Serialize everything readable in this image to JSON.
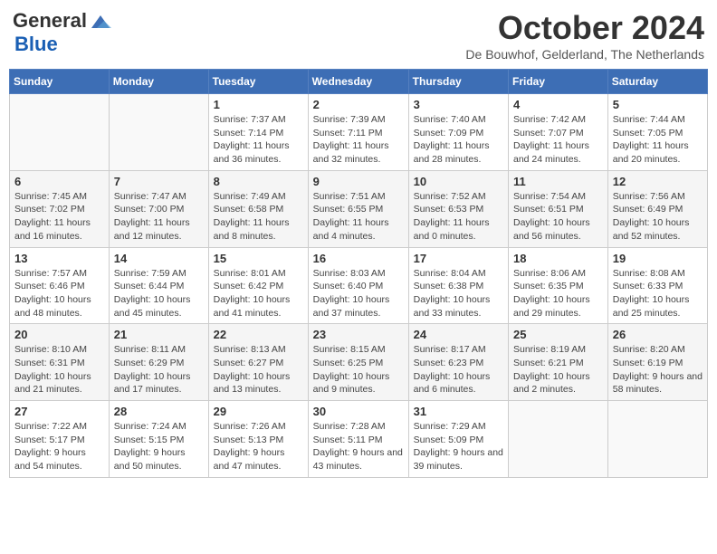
{
  "logo": {
    "general": "General",
    "blue": "Blue"
  },
  "header": {
    "title": "October 2024",
    "subtitle": "De Bouwhof, Gelderland, The Netherlands"
  },
  "days_of_week": [
    "Sunday",
    "Monday",
    "Tuesday",
    "Wednesday",
    "Thursday",
    "Friday",
    "Saturday"
  ],
  "weeks": [
    [
      {
        "day": "",
        "info": ""
      },
      {
        "day": "",
        "info": ""
      },
      {
        "day": "1",
        "info": "Sunrise: 7:37 AM\nSunset: 7:14 PM\nDaylight: 11 hours and 36 minutes."
      },
      {
        "day": "2",
        "info": "Sunrise: 7:39 AM\nSunset: 7:11 PM\nDaylight: 11 hours and 32 minutes."
      },
      {
        "day": "3",
        "info": "Sunrise: 7:40 AM\nSunset: 7:09 PM\nDaylight: 11 hours and 28 minutes."
      },
      {
        "day": "4",
        "info": "Sunrise: 7:42 AM\nSunset: 7:07 PM\nDaylight: 11 hours and 24 minutes."
      },
      {
        "day": "5",
        "info": "Sunrise: 7:44 AM\nSunset: 7:05 PM\nDaylight: 11 hours and 20 minutes."
      }
    ],
    [
      {
        "day": "6",
        "info": "Sunrise: 7:45 AM\nSunset: 7:02 PM\nDaylight: 11 hours and 16 minutes."
      },
      {
        "day": "7",
        "info": "Sunrise: 7:47 AM\nSunset: 7:00 PM\nDaylight: 11 hours and 12 minutes."
      },
      {
        "day": "8",
        "info": "Sunrise: 7:49 AM\nSunset: 6:58 PM\nDaylight: 11 hours and 8 minutes."
      },
      {
        "day": "9",
        "info": "Sunrise: 7:51 AM\nSunset: 6:55 PM\nDaylight: 11 hours and 4 minutes."
      },
      {
        "day": "10",
        "info": "Sunrise: 7:52 AM\nSunset: 6:53 PM\nDaylight: 11 hours and 0 minutes."
      },
      {
        "day": "11",
        "info": "Sunrise: 7:54 AM\nSunset: 6:51 PM\nDaylight: 10 hours and 56 minutes."
      },
      {
        "day": "12",
        "info": "Sunrise: 7:56 AM\nSunset: 6:49 PM\nDaylight: 10 hours and 52 minutes."
      }
    ],
    [
      {
        "day": "13",
        "info": "Sunrise: 7:57 AM\nSunset: 6:46 PM\nDaylight: 10 hours and 48 minutes."
      },
      {
        "day": "14",
        "info": "Sunrise: 7:59 AM\nSunset: 6:44 PM\nDaylight: 10 hours and 45 minutes."
      },
      {
        "day": "15",
        "info": "Sunrise: 8:01 AM\nSunset: 6:42 PM\nDaylight: 10 hours and 41 minutes."
      },
      {
        "day": "16",
        "info": "Sunrise: 8:03 AM\nSunset: 6:40 PM\nDaylight: 10 hours and 37 minutes."
      },
      {
        "day": "17",
        "info": "Sunrise: 8:04 AM\nSunset: 6:38 PM\nDaylight: 10 hours and 33 minutes."
      },
      {
        "day": "18",
        "info": "Sunrise: 8:06 AM\nSunset: 6:35 PM\nDaylight: 10 hours and 29 minutes."
      },
      {
        "day": "19",
        "info": "Sunrise: 8:08 AM\nSunset: 6:33 PM\nDaylight: 10 hours and 25 minutes."
      }
    ],
    [
      {
        "day": "20",
        "info": "Sunrise: 8:10 AM\nSunset: 6:31 PM\nDaylight: 10 hours and 21 minutes."
      },
      {
        "day": "21",
        "info": "Sunrise: 8:11 AM\nSunset: 6:29 PM\nDaylight: 10 hours and 17 minutes."
      },
      {
        "day": "22",
        "info": "Sunrise: 8:13 AM\nSunset: 6:27 PM\nDaylight: 10 hours and 13 minutes."
      },
      {
        "day": "23",
        "info": "Sunrise: 8:15 AM\nSunset: 6:25 PM\nDaylight: 10 hours and 9 minutes."
      },
      {
        "day": "24",
        "info": "Sunrise: 8:17 AM\nSunset: 6:23 PM\nDaylight: 10 hours and 6 minutes."
      },
      {
        "day": "25",
        "info": "Sunrise: 8:19 AM\nSunset: 6:21 PM\nDaylight: 10 hours and 2 minutes."
      },
      {
        "day": "26",
        "info": "Sunrise: 8:20 AM\nSunset: 6:19 PM\nDaylight: 9 hours and 58 minutes."
      }
    ],
    [
      {
        "day": "27",
        "info": "Sunrise: 7:22 AM\nSunset: 5:17 PM\nDaylight: 9 hours and 54 minutes."
      },
      {
        "day": "28",
        "info": "Sunrise: 7:24 AM\nSunset: 5:15 PM\nDaylight: 9 hours and 50 minutes."
      },
      {
        "day": "29",
        "info": "Sunrise: 7:26 AM\nSunset: 5:13 PM\nDaylight: 9 hours and 47 minutes."
      },
      {
        "day": "30",
        "info": "Sunrise: 7:28 AM\nSunset: 5:11 PM\nDaylight: 9 hours and 43 minutes."
      },
      {
        "day": "31",
        "info": "Sunrise: 7:29 AM\nSunset: 5:09 PM\nDaylight: 9 hours and 39 minutes."
      },
      {
        "day": "",
        "info": ""
      },
      {
        "day": "",
        "info": ""
      }
    ]
  ]
}
